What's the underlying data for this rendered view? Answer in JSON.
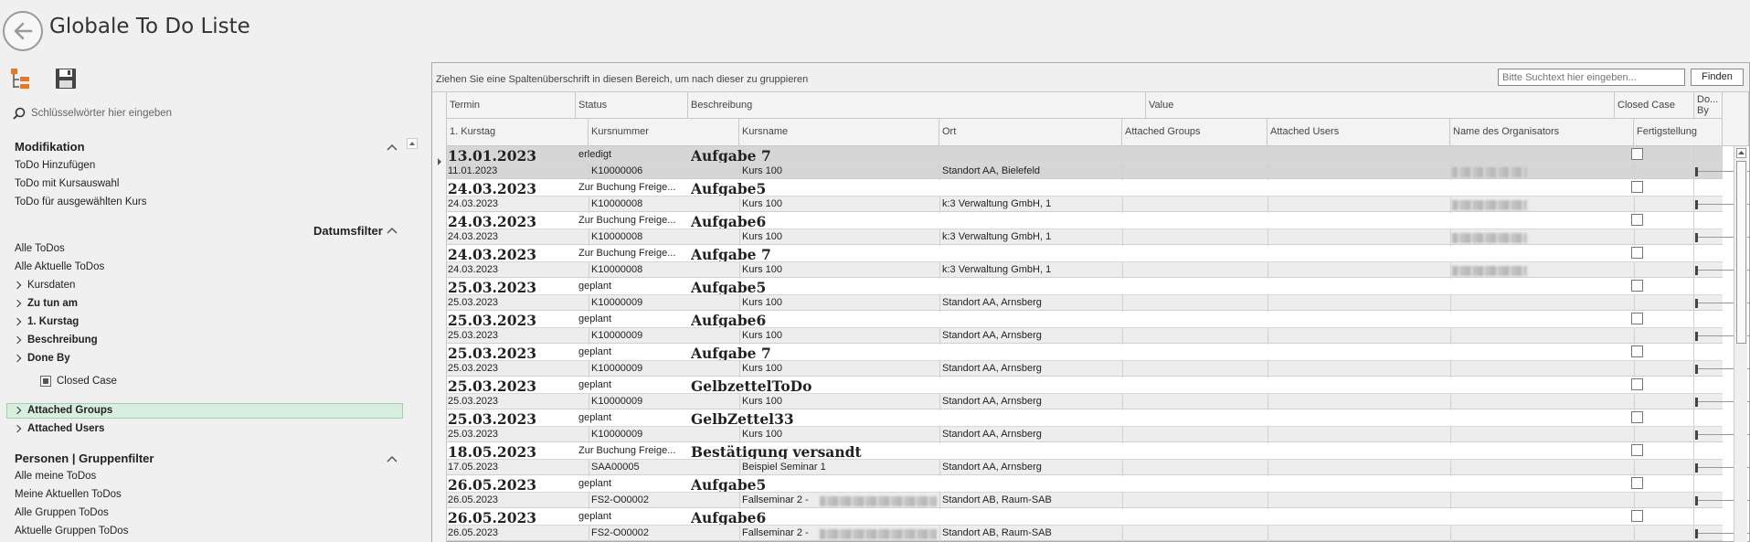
{
  "window": {
    "title": "Globale To Do Liste"
  },
  "left_panel": {
    "search_placeholder": "Schlüsselwörter hier eingeben",
    "modifikation": {
      "title": "Modifikation",
      "items": [
        "ToDo Hinzufügen",
        "ToDo mit Kursauswahl",
        "ToDo für ausgewählten Kurs"
      ]
    },
    "datumsfilter": {
      "title": "Datumsfilter"
    },
    "filters": {
      "alle": "Alle ToDos",
      "aktuelle": "Alle Aktuelle ToDos",
      "expandable": [
        "Kursdaten",
        "Zu tun am",
        "1. Kurstag",
        "Beschreibung",
        "Done By"
      ],
      "closed_case": "Closed Case",
      "groups": [
        "Attached Groups",
        "Attached Users"
      ]
    },
    "personen": {
      "title": "Personen | Gruppenfilter",
      "items": [
        "Alle meine ToDos",
        "Meine Aktuellen ToDos",
        "Alle Gruppen ToDos",
        "Aktuelle Gruppen ToDos"
      ]
    }
  },
  "grid": {
    "group_hint": "Ziehen Sie eine Spaltenüberschrift in diesen Bereich, um nach dieser zu gruppieren",
    "search_placeholder": "Bitte Suchtext hier eingeben...",
    "find_label": "Finden",
    "headers_row1": [
      "Termin",
      "Status",
      "Beschreibung",
      "Value",
      "Closed Case",
      "Do... By"
    ],
    "headers_row2": [
      "1. Kurstag",
      "Kursnummer",
      "Kursname",
      "Ort",
      "Attached Groups",
      "Attached Users",
      "Name des Organisators",
      "Fertigstellung"
    ],
    "rows": [
      {
        "termin": "13.01.2023",
        "status": "erledigt",
        "desc": "Aufgabe 7",
        "kurstag": "11.01.2023",
        "kursnr": "K10000006",
        "kursname": "Kurs 100",
        "ort": "Standort AA, Bielefeld",
        "org": true
      },
      {
        "termin": "24.03.2023",
        "status": "Zur Buchung Freige...",
        "desc": "Aufgabe5",
        "kurstag": "24.03.2023",
        "kursnr": "K10000008",
        "kursname": "Kurs 100",
        "ort": "k:3 Verwaltung GmbH, 1",
        "org": true
      },
      {
        "termin": "24.03.2023",
        "status": "Zur Buchung Freige...",
        "desc": "Aufgabe6",
        "kurstag": "24.03.2023",
        "kursnr": "K10000008",
        "kursname": "Kurs 100",
        "ort": "k:3 Verwaltung GmbH, 1",
        "org": true
      },
      {
        "termin": "24.03.2023",
        "status": "Zur Buchung Freige...",
        "desc": "Aufgabe 7",
        "kurstag": "24.03.2023",
        "kursnr": "K10000008",
        "kursname": "Kurs 100",
        "ort": "k:3 Verwaltung GmbH, 1",
        "org": true
      },
      {
        "termin": "25.03.2023",
        "status": "geplant",
        "desc": "Aufgabe5",
        "kurstag": "25.03.2023",
        "kursnr": "K10000009",
        "kursname": "Kurs 100",
        "ort": "Standort AA, Arnsberg",
        "org": false
      },
      {
        "termin": "25.03.2023",
        "status": "geplant",
        "desc": "Aufgabe6",
        "kurstag": "25.03.2023",
        "kursnr": "K10000009",
        "kursname": "Kurs 100",
        "ort": "Standort AA, Arnsberg",
        "org": false
      },
      {
        "termin": "25.03.2023",
        "status": "geplant",
        "desc": "Aufgabe 7",
        "kurstag": "25.03.2023",
        "kursnr": "K10000009",
        "kursname": "Kurs 100",
        "ort": "Standort AA, Arnsberg",
        "org": false
      },
      {
        "termin": "25.03.2023",
        "status": "geplant",
        "desc": "GelbzettelToDo",
        "kurstag": "25.03.2023",
        "kursnr": "K10000009",
        "kursname": "Kurs 100",
        "ort": "Standort AA, Arnsberg",
        "org": false
      },
      {
        "termin": "25.03.2023",
        "status": "geplant",
        "desc": "GelbZettel33",
        "kurstag": "25.03.2023",
        "kursnr": "K10000009",
        "kursname": "Kurs 100",
        "ort": "Standort AA, Arnsberg",
        "org": false
      },
      {
        "termin": "18.05.2023",
        "status": "Zur Buchung Freige...",
        "desc": "Bestätigung versandt",
        "kurstag": "17.05.2023",
        "kursnr": "SAA00005",
        "kursname": "Beispiel Seminar 1",
        "ort": "Standort AA, Arnsberg",
        "org": false
      },
      {
        "termin": "26.05.2023",
        "status": "geplant",
        "desc": "Aufgabe5",
        "kurstag": "26.05.2023",
        "kursnr": "FS2-O00002",
        "kursname": "Fallseminar 2 -",
        "ort": "Standort AB, Raum-SAB",
        "org": false,
        "blur_kurs": true
      },
      {
        "termin": "26.05.2023",
        "status": "geplant",
        "desc": "Aufgabe6",
        "kurstag": "26.05.2023",
        "kursnr": "FS2-O00002",
        "kursname": "Fallseminar 2 -",
        "ort": "Standort AB, Raum-SAB",
        "org": false,
        "blur_kurs": true
      }
    ]
  }
}
